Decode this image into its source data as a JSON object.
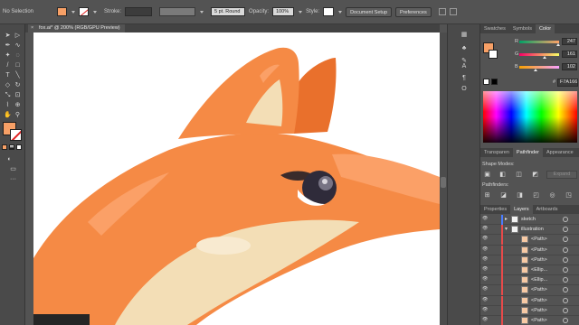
{
  "control_bar": {
    "selection_label": "No Selection",
    "stroke_label": "Stroke:",
    "brush_value": "5 pt. Round",
    "opacity_label": "Opacity:",
    "opacity_value": "100%",
    "style_label": "Style:",
    "document_setup": "Document Setup",
    "preferences": "Preferences"
  },
  "document_tab": {
    "close_glyph": "×",
    "title": "fox.ai* @ 200% (RGB/GPU Preview)"
  },
  "colors": {
    "fill": "#F7A066",
    "fox_orange": "#F58A45",
    "fox_light": "#FBA067",
    "fox_dark": "#E9702C",
    "fox_cream": "#F3DEB6"
  },
  "panels": {
    "top_tabs": [
      "Swatches",
      "Symbols",
      "Color"
    ],
    "active_top_tab": "Color",
    "color": {
      "channels": [
        {
          "label": "R",
          "value": "247",
          "fraction": 0.97
        },
        {
          "label": "G",
          "value": "161",
          "fraction": 0.63
        },
        {
          "label": "B",
          "value": "102",
          "fraction": 0.4
        }
      ],
      "hash": "#",
      "hex": "F7A166"
    },
    "mid_tabs": [
      "Transparen",
      "Pathfinder",
      "Appearance"
    ],
    "active_mid_tab": "Pathfinder",
    "shape_modes_label": "Shape Modes:",
    "expand_label": "Expand",
    "pathfinders_label": "Pathfinders:",
    "layer_tabs": [
      "Properties",
      "Layers",
      "Artboards"
    ],
    "active_layer_tab": "Layers",
    "layers": [
      {
        "name": "sketch",
        "level": 0,
        "expanded": false,
        "color": "#4a7cff"
      },
      {
        "name": "illustration",
        "level": 0,
        "expanded": true,
        "color": "#e84a4a"
      },
      {
        "name": "<Path>",
        "level": 1,
        "color": "#e84a4a"
      },
      {
        "name": "<Path>",
        "level": 1,
        "color": "#e84a4a"
      },
      {
        "name": "<Path>",
        "level": 1,
        "color": "#e84a4a"
      },
      {
        "name": "<Ellip...",
        "level": 1,
        "color": "#e84a4a"
      },
      {
        "name": "<Ellip...",
        "level": 1,
        "color": "#e84a4a"
      },
      {
        "name": "<Path>",
        "level": 1,
        "color": "#e84a4a"
      },
      {
        "name": "<Path>",
        "level": 1,
        "color": "#e84a4a"
      },
      {
        "name": "<Path>",
        "level": 1,
        "color": "#e84a4a"
      },
      {
        "name": "<Path>",
        "level": 1,
        "color": "#e84a4a"
      }
    ]
  }
}
